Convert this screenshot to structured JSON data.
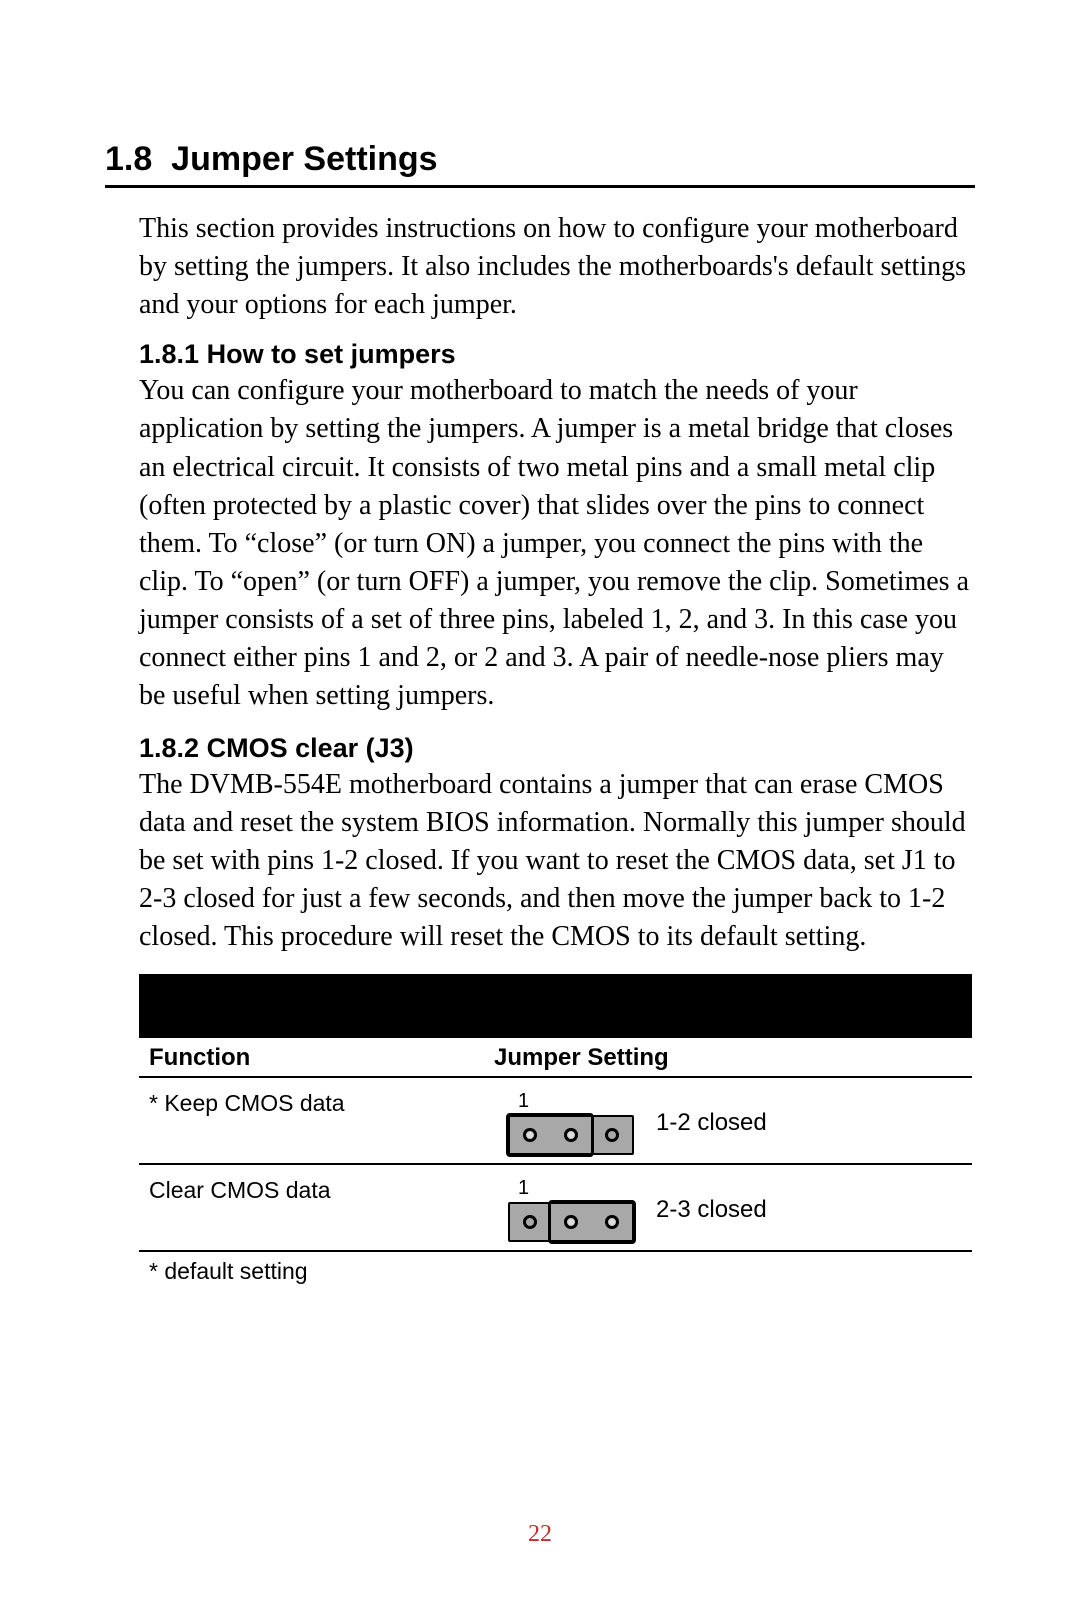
{
  "section": {
    "number": "1.8",
    "title": "Jumper Settings",
    "intro": "This section provides instructions on how to configure your motherboard by setting the jumpers. It also includes the motherboards's default settings and your options for each jumper."
  },
  "sub1": {
    "number": "1.8.1",
    "title": "How to set jumpers",
    "body": "You can configure your motherboard to match the needs of your application by setting the jumpers. A jumper is a metal bridge that closes an electrical circuit. It consists of two metal pins and a small metal clip (often protected by a plastic cover) that slides over the pins to connect them. To “close” (or turn ON) a jumper, you connect the pins with the clip. To “open” (or turn OFF) a jumper, you remove the clip. Sometimes a jumper consists of a set of three pins, labeled 1, 2, and 3. In this case you connect either pins 1 and 2, or 2 and 3. A pair of needle-nose pliers may be useful when setting jumpers."
  },
  "sub2": {
    "number": "1.8.2",
    "title": "CMOS clear (J3)",
    "body": "The DVMB-554E motherboard contains a jumper that can erase CMOS data and reset the system BIOS information. Normally this jumper should be set with pins 1-2 closed. If you want to reset the CMOS data, set J1 to 2-3 closed for just a few seconds, and then move the jumper back to 1-2 closed. This procedure will reset the CMOS to its default setting."
  },
  "table": {
    "headers": {
      "function": "Function",
      "setting": "Jumper Setting"
    },
    "pin1_label": "1",
    "rows": [
      {
        "function": "* Keep CMOS data",
        "setting": "1-2 closed",
        "cap": "left"
      },
      {
        "function": "Clear CMOS data",
        "setting": "2-3 closed",
        "cap": "right"
      }
    ],
    "footnote": "* default setting"
  },
  "page_number": "22"
}
